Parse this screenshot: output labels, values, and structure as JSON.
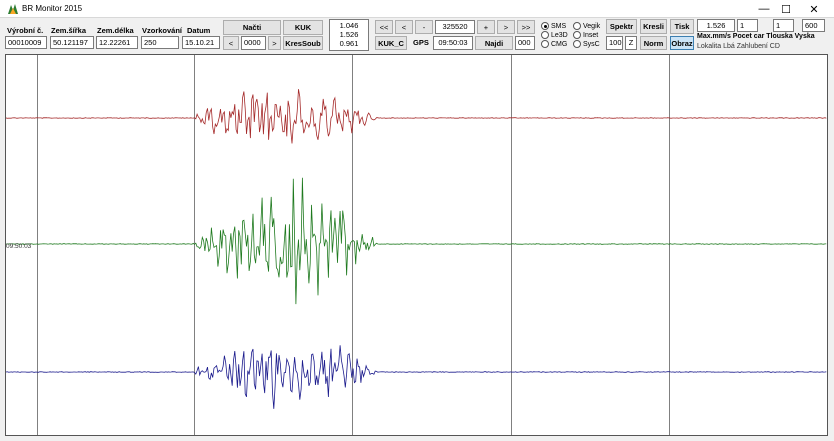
{
  "window": {
    "title": "BR Monitor 2015",
    "minimize": "—",
    "maximize": "☐",
    "close": "✕"
  },
  "params": {
    "station_label": "Výrobní č.",
    "station_value": "00010009",
    "lat_label": "Zem.šířka",
    "lat_value": "50.121197",
    "lon_label": "Zem.délka",
    "lon_value": "12.22261",
    "rate_label": "Vzorkování",
    "rate_value": "250",
    "date_label": "Datum",
    "date_value": "15.10.21"
  },
  "file": {
    "load": "Načti",
    "kuk": "KUK",
    "prev": "<",
    "index": "0000",
    "next": ">",
    "draw_file": "KresSoub"
  },
  "readout": {
    "line1": "1.046",
    "line2": "1.526",
    "line3": "0.961"
  },
  "nav": {
    "first": "<<",
    "back": "<",
    "minus": "-",
    "position": "325520",
    "plus": "+",
    "forward": ">",
    "last": ">>",
    "kuk_c": "KUK_C",
    "gps_label": "GPS",
    "time": "09:50:03",
    "find": "Najdi",
    "offset": "000"
  },
  "radios": [
    {
      "label": "SMS",
      "checked": true
    },
    {
      "label": "Le3D",
      "checked": false
    },
    {
      "label": "CMG",
      "checked": false
    },
    {
      "label": "Vegik",
      "checked": false
    },
    {
      "label": "Inset",
      "checked": false
    },
    {
      "label": "SysC",
      "checked": false
    }
  ],
  "spectrum": {
    "label": "Spektr",
    "value": "100",
    "z_label": "Z"
  },
  "draw": {
    "draw": "Kresli",
    "norm": "Norm",
    "print": "Tisk",
    "image": "Obraz"
  },
  "scale": {
    "max_value": "1.526",
    "count_value": "1",
    "thickness_value": "1",
    "height_value": "600",
    "header_text": "Max.mm/s Pocet car Tlouska Vyska",
    "footer_text": "Lokalita  Lbá  Zahlubení  CD"
  },
  "plot": {
    "time_label": "09:50:03"
  },
  "traces": [
    {
      "name": "channel-1",
      "color": "#a52a2a"
    },
    {
      "name": "channel-2",
      "color": "#1f7a1f"
    },
    {
      "name": "channel-3",
      "color": "#1a1a8c"
    }
  ]
}
